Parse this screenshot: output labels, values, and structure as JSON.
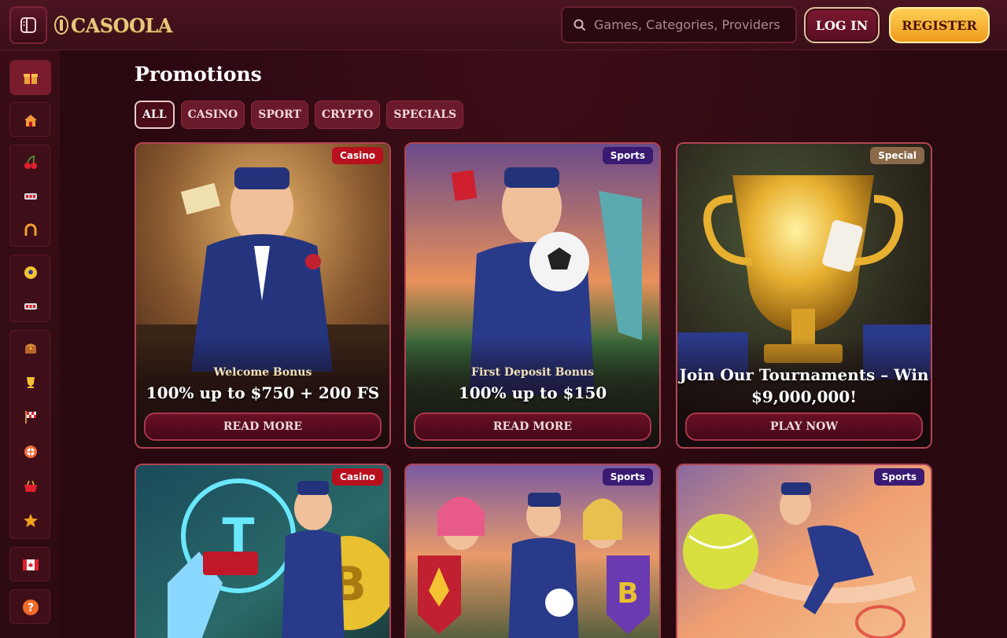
{
  "header": {
    "logo_text": "CASOOLA",
    "search_placeholder": "Games, Categories, Providers",
    "login_label": "LOG IN",
    "register_label": "REGISTER"
  },
  "sidebar": {
    "items": [
      {
        "icon": "gift-icon",
        "active": true
      },
      {
        "icon": "home-icon"
      },
      {
        "icon": "cherry-icon"
      },
      {
        "icon": "slot-machine-icon"
      },
      {
        "icon": "horseshoe-icon"
      },
      {
        "icon": "soccer-ball-icon"
      },
      {
        "icon": "slot-machine-icon"
      },
      {
        "icon": "treasure-chest-icon"
      },
      {
        "icon": "trophy-icon"
      },
      {
        "icon": "race-flag-icon"
      },
      {
        "icon": "wheel-icon"
      },
      {
        "icon": "basket-icon"
      },
      {
        "icon": "star-icon"
      },
      {
        "icon": "canada-flag-icon"
      },
      {
        "icon": "help-icon"
      }
    ]
  },
  "main": {
    "title": "Promotions",
    "filters": [
      "ALL",
      "CASINO",
      "SPORT",
      "CRYPTO",
      "SPECIALS"
    ],
    "active_filter": "ALL",
    "cards": [
      {
        "tag": "Casino",
        "subtitle": "Welcome Bonus",
        "headline": "100% up to $750 + 200 FS",
        "cta": "READ MORE"
      },
      {
        "tag": "Sports",
        "subtitle": "First Deposit Bonus",
        "headline": "100% up to $150",
        "cta": "READ MORE"
      },
      {
        "tag": "Special",
        "subtitle": "",
        "headline": "Join Our Tournaments – Win $9,000,000!",
        "cta": "PLAY NOW"
      },
      {
        "tag": "Casino"
      },
      {
        "tag": "Sports"
      },
      {
        "tag": "Sports"
      }
    ]
  },
  "colors": {
    "background": "#2a0a10",
    "accent_gold": "#ffc13a",
    "casino_tag": "#b9101e",
    "sports_tag": "#3a1a72",
    "special_tag": "#8a6a4a"
  }
}
